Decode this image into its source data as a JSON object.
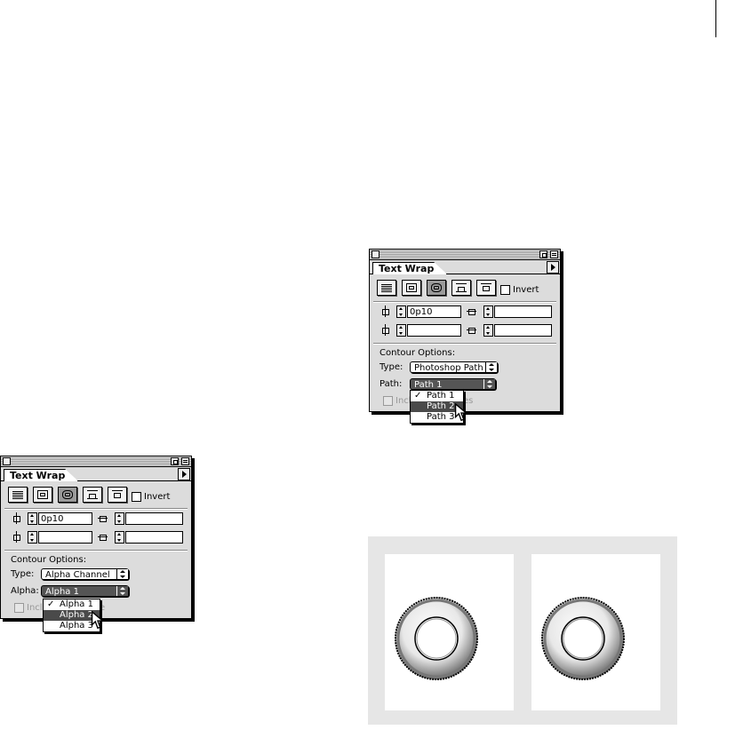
{
  "panel_large": {
    "tab_title": "Text Wrap",
    "invert_label": "Invert",
    "top_offset_value": "0p10",
    "bottom_offset_value": "",
    "left_offset_value": "",
    "right_offset_value": "",
    "contour_options_label": "Contour Options:",
    "type_label": "Type:",
    "type_value": "Photoshop Path",
    "path_label": "Path:",
    "path_value": "Path 1",
    "include_label": "Incl",
    "include_suffix": "es",
    "dropdown_items": [
      {
        "label": "Path 1",
        "checked": true
      },
      {
        "label": "Path 2",
        "highlighted": true
      },
      {
        "label": "Path 3"
      }
    ]
  },
  "panel_small": {
    "tab_title": "Text Wrap",
    "invert_label": "Invert",
    "top_offset_value": "0p10",
    "bottom_offset_value": "",
    "left_offset_value": "",
    "right_offset_value": "",
    "contour_options_label": "Contour Options:",
    "type_label": "Type:",
    "type_value": "Alpha Channel",
    "alpha_label": "Alpha:",
    "alpha_value": "Alpha 1",
    "include_label": "Incl",
    "include_suffix": "e",
    "dropdown_items": [
      {
        "label": "Alpha 1",
        "checked": true
      },
      {
        "label": "Alpha 2",
        "highlighted": true
      },
      {
        "label": "Alpha 3"
      }
    ]
  },
  "check_glyph": "✓",
  "colors": {
    "palette_bg": "#dcdcdc",
    "highlight": "#4a4a4a",
    "figure_bg": "#e6e6e6"
  }
}
